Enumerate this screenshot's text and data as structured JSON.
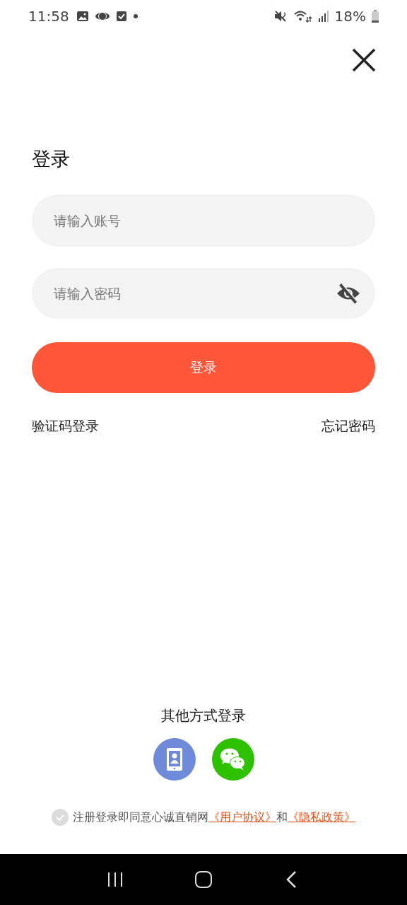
{
  "status_bar": {
    "time": "11:58",
    "battery": "18%"
  },
  "title": "登录",
  "account_field": {
    "placeholder": "请输入账号"
  },
  "password_field": {
    "placeholder": "请输入密码",
    "visible": false
  },
  "login_button": "登录",
  "links": {
    "sms_login": "验证码登录",
    "forgot_password": "忘记密码"
  },
  "other_login": {
    "heading": "其他方式登录",
    "methods": [
      {
        "kind": "phone",
        "color": "#6e8ad8"
      },
      {
        "kind": "wechat",
        "color": "#2dc100"
      }
    ]
  },
  "agreement": {
    "checked": false,
    "text": "注册登录即同意心诚直销网",
    "user_agreement": "《用户协议》",
    "conjunction": "和",
    "privacy_policy": "《隐私政策》"
  }
}
